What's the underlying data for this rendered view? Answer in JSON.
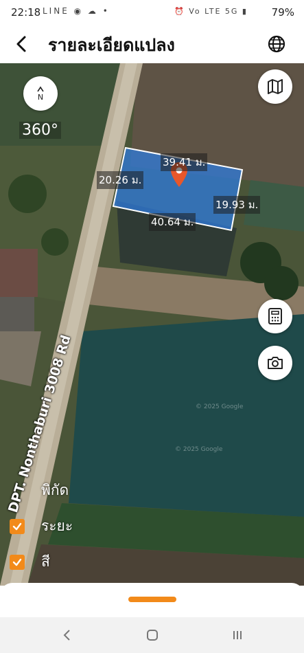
{
  "status_bar": {
    "time": "22:18",
    "left_icons": "LINE ◉ ☁ •",
    "right_icons": "⏰ Vo LTE 5G ▮",
    "battery": "79%"
  },
  "header": {
    "title": "รายละเอียดแปลง"
  },
  "map": {
    "compass_letter": "N",
    "bearing": "360°",
    "road_name": "DPT. Nonthaburi 3008 Rd",
    "dimensions": {
      "top": "39.41 ม.",
      "left": "20.26 ม.",
      "right": "19.93 ม.",
      "bottom": "40.64 ม."
    },
    "watermark": "© 2025 Google"
  },
  "layers": [
    {
      "label": "พิกัด",
      "checked": false
    },
    {
      "label": "ระยะ",
      "checked": true
    },
    {
      "label": "สี",
      "checked": true
    }
  ],
  "colors": {
    "accent": "#f28a1a",
    "plot_fill": "#2f7bdc",
    "pin": "#e8572a"
  }
}
